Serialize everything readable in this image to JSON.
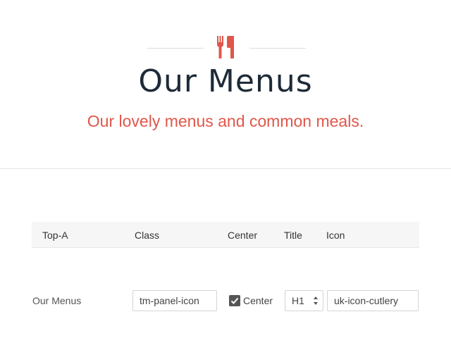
{
  "hero": {
    "title": "Our Menus",
    "subtitle": "Our lovely menus and common meals.",
    "icon": "cutlery-icon",
    "accent_color": "#e0574a",
    "title_color": "#1d2a38"
  },
  "table": {
    "headers": [
      "Top-A",
      "Class",
      "Center",
      "Title",
      "Icon"
    ],
    "row": {
      "label": "Our Menus",
      "class_value": "tm-panel-icon",
      "center_checked": true,
      "center_label": "Center",
      "title_value": "H1",
      "icon_value": "uk-icon-cutlery"
    }
  }
}
